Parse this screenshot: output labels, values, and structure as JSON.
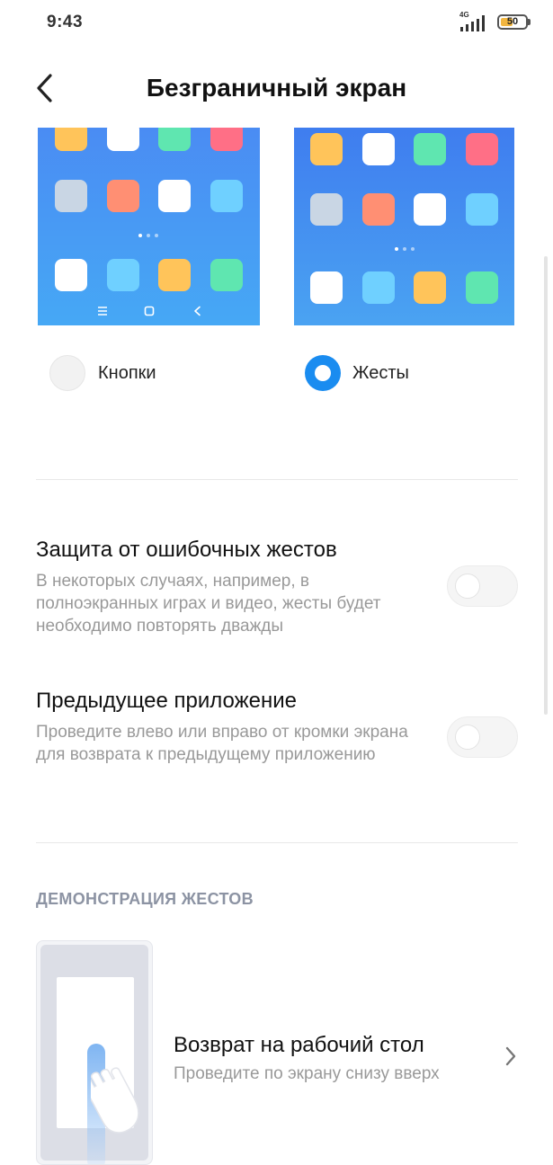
{
  "status": {
    "time": "9:43",
    "network": "4G",
    "battery": "50",
    "battery_level": 0.5,
    "battery_color": "#f2b640"
  },
  "header": {
    "title": "Безграничный экран"
  },
  "options": {
    "buttons_label": "Кнопки",
    "gestures_label": "Жесты",
    "selected": "gestures",
    "accent_color": "#1a8cf0"
  },
  "settings": [
    {
      "title": "Защита от ошибочных жестов",
      "description": "В некоторых случаях, например, в полноэкранных играх и видео, жесты будет необходимо повторять дважды",
      "enabled": false
    },
    {
      "title": "Предыдущее приложение",
      "description": "Проведите влево или вправо от кромки экрана для возврата к предыдущему приложению",
      "enabled": false
    }
  ],
  "demo_section": {
    "header": "ДЕМОНСТРАЦИЯ ЖЕСТОВ",
    "items": [
      {
        "title": "Возврат на рабочий стол",
        "description": "Проведите по экрану снизу вверх"
      }
    ]
  },
  "icons": [
    "back-arrow-icon",
    "signal-icon",
    "battery-icon",
    "menu-nav-icon",
    "home-nav-icon",
    "back-nav-icon",
    "chevron-right-icon",
    "swipe-hand-icon"
  ],
  "preview_tile_colors": [
    "#ffc45a",
    "#ffffff",
    "#5fe6b0",
    "#ff6f86",
    "#c9d6e4",
    "#ff8f73",
    "#6fd0ff"
  ]
}
